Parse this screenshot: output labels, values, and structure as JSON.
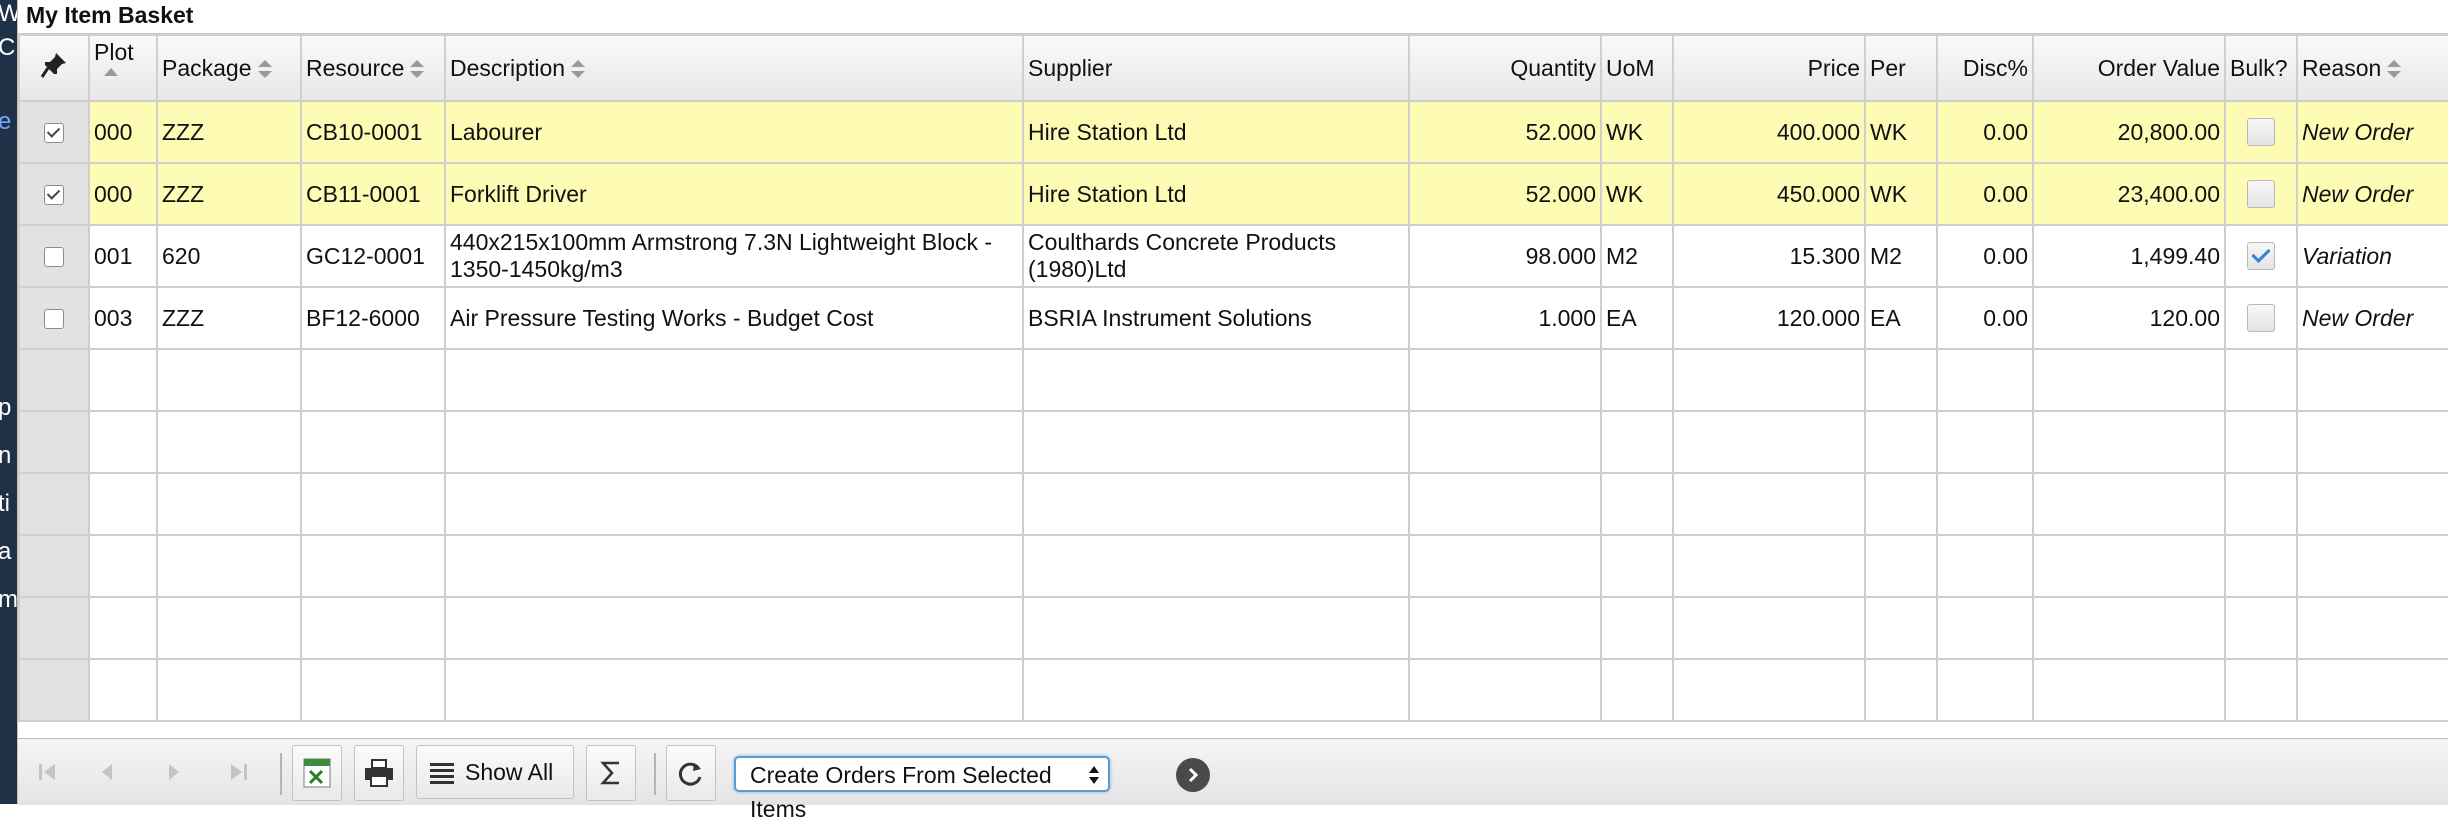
{
  "background_letters": [
    "W",
    "C",
    "e",
    "p",
    "n",
    "ti",
    "a",
    "m"
  ],
  "panel": {
    "title": "My Item Basket"
  },
  "columns": {
    "plot": "Plot",
    "package": "Package",
    "resource": "Resource",
    "description": "Description",
    "supplier": "Supplier",
    "quantity": "Quantity",
    "uom": "UoM",
    "price": "Price",
    "per": "Per",
    "disc": "Disc%",
    "order_value": "Order Value",
    "bulk": "Bulk?",
    "reason": "Reason"
  },
  "rows": [
    {
      "selected": true,
      "plot": "000",
      "package": "ZZZ",
      "resource": "CB10-0001",
      "description": "Labourer",
      "supplier": "Hire Station Ltd",
      "quantity": "52.000",
      "uom": "WK",
      "price": "400.000",
      "per": "WK",
      "disc": "0.00",
      "order_value": "20,800.00",
      "bulk": false,
      "reason": "New Order"
    },
    {
      "selected": true,
      "plot": "000",
      "package": "ZZZ",
      "resource": "CB11-0001",
      "description": "Forklift Driver",
      "supplier": "Hire Station Ltd",
      "quantity": "52.000",
      "uom": "WK",
      "price": "450.000",
      "per": "WK",
      "disc": "0.00",
      "order_value": "23,400.00",
      "bulk": false,
      "reason": "New Order"
    },
    {
      "selected": false,
      "plot": "001",
      "package": "620",
      "resource": "GC12-0001",
      "description": "440x215x100mm Armstrong 7.3N Lightweight Block - 1350-1450kg/m3",
      "supplier": "Coulthards Concrete Products (1980)Ltd",
      "quantity": "98.000",
      "uom": "M2",
      "price": "15.300",
      "per": "M2",
      "disc": "0.00",
      "order_value": "1,499.40",
      "bulk": true,
      "reason": "Variation"
    },
    {
      "selected": false,
      "plot": "003",
      "package": "ZZZ",
      "resource": "BF12-6000",
      "description": "Air Pressure Testing Works - Budget Cost",
      "supplier": "BSRIA Instrument Solutions",
      "quantity": "1.000",
      "uom": "EA",
      "price": "120.000",
      "per": "EA",
      "disc": "0.00",
      "order_value": "120.00",
      "bulk": false,
      "reason": "New Order"
    }
  ],
  "toolbar": {
    "show_all_label": "Show All",
    "action_select": {
      "value": "Create Orders From Selected Items",
      "options": [
        "Create Orders From Selected Items"
      ]
    }
  },
  "colors": {
    "selected_row": "#fefcb4",
    "header_bg": "#ececec",
    "select_border": "#5b9bd5"
  }
}
